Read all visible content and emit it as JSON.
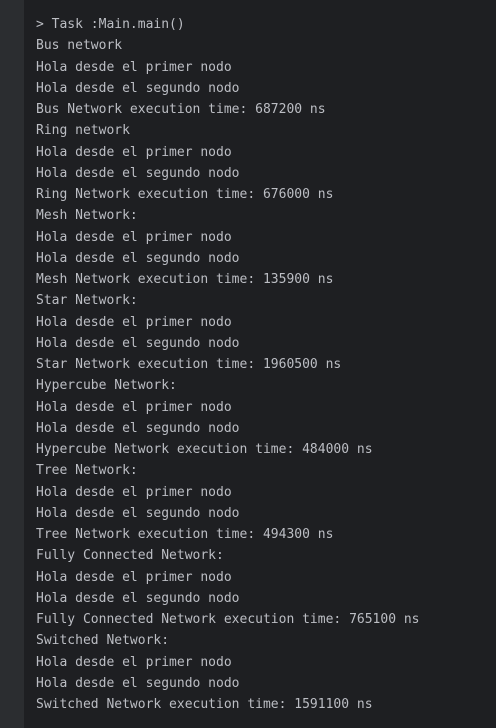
{
  "console": {
    "text_color": "#bcbec4",
    "background": "#1e1f22",
    "gutter_background": "#2b2d30",
    "lines": [
      "> Task :Main.main()",
      "Bus network",
      "Hola desde el primer nodo",
      "Hola desde el segundo nodo",
      "Bus Network execution time: 687200 ns",
      "Ring network",
      "Hola desde el primer nodo",
      "Hola desde el segundo nodo",
      "Ring Network execution time: 676000 ns",
      "Mesh Network:",
      "Hola desde el primer nodo",
      "Hola desde el segundo nodo",
      "Mesh Network execution time: 135900 ns",
      "Star Network:",
      "Hola desde el primer nodo",
      "Hola desde el segundo nodo",
      "Star Network execution time: 1960500 ns",
      "Hypercube Network:",
      "Hola desde el primer nodo",
      "Hola desde el segundo nodo",
      "Hypercube Network execution time: 484000 ns",
      "Tree Network:",
      "Hola desde el primer nodo",
      "Hola desde el segundo nodo",
      "Tree Network execution time: 494300 ns",
      "Fully Connected Network:",
      "Hola desde el primer nodo",
      "Hola desde el segundo nodo",
      "Fully Connected Network execution time: 765100 ns",
      "Switched Network:",
      "Hola desde el primer nodo",
      "Hola desde el segundo nodo",
      "Switched Network execution time: 1591100 ns"
    ]
  }
}
